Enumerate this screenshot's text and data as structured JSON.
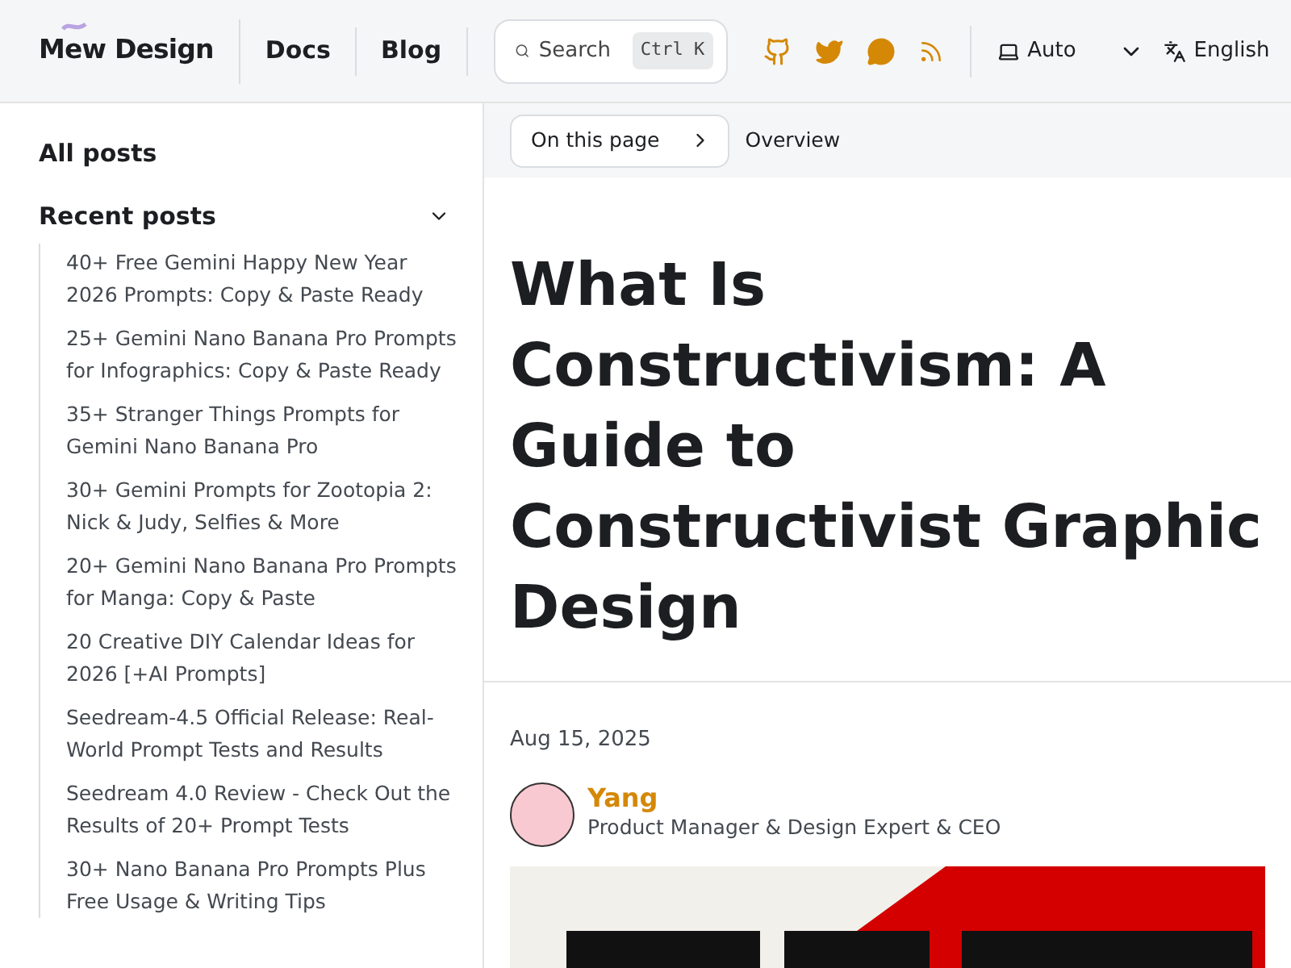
{
  "header": {
    "logo": "Mew Design",
    "nav": [
      {
        "label": "Docs"
      },
      {
        "label": "Blog"
      }
    ],
    "search": {
      "placeholder": "Search",
      "shortcut": "Ctrl K"
    },
    "theme": "Auto",
    "language": "English"
  },
  "sidebar": {
    "all_posts": "All posts",
    "section": {
      "title": "Recent posts",
      "expanded": true,
      "items": [
        {
          "label": "40+ Free Gemini Happy New Year 2026 Prompts: Copy & Paste Ready"
        },
        {
          "label": "25+ Gemini Nano Banana Pro Prompts for Infographics: Copy & Paste Ready"
        },
        {
          "label": "35+ Stranger Things Prompts for Gemini Nano Banana Pro"
        },
        {
          "label": "30+ Gemini Prompts for Zootopia 2: Nick & Judy, Selfies & More"
        },
        {
          "label": "20+ Gemini Nano Banana Pro Prompts for Manga: Copy & Paste"
        },
        {
          "label": "20 Creative DIY Calendar Ideas for 2026 [+AI Prompts]"
        },
        {
          "label": "Seedream-4.5 Official Release: Real-World Prompt Tests and Results"
        },
        {
          "label": "Seedream 4.0 Review - Check Out the Results of 20+ Prompt Tests"
        },
        {
          "label": "30+ Nano Banana Pro Prompts Plus Free Usage & Writing Tips"
        }
      ]
    }
  },
  "breadcrumb": {
    "toc_button": "On this page",
    "current": "Overview"
  },
  "article": {
    "title": "What Is Constructivism: A Guide to Constructivist Graphic Design",
    "date": "Aug 15, 2025",
    "author": {
      "name": "Yang",
      "role": "Product Manager & Design Expert & CEO"
    }
  }
}
